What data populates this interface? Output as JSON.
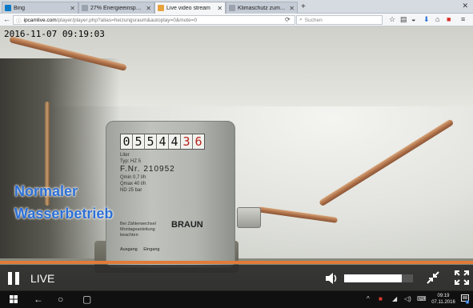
{
  "browser": {
    "tabs": [
      {
        "title": "Bing",
        "favicon_color": "#0a7ac4",
        "active": false
      },
      {
        "title": "27% Energieeinsparung - Hei...",
        "favicon_color": "#9aa3ad",
        "active": false
      },
      {
        "title": "Live video stream",
        "favicon_color": "#e8a341",
        "active": true
      },
      {
        "title": "Klimaschutz zum Nulltarif - H...",
        "favicon_color": "#9aa3ad",
        "active": false
      }
    ],
    "new_tab_label": "+",
    "url_domain": "ipcamlive.com",
    "url_path": "/player/player.php?alias=heizungsraum&autoplay=0&mute=0",
    "search_placeholder": "Suchen"
  },
  "video": {
    "timestamp": "2016-11-07  09:19:03",
    "overlay_line1": "Normaler",
    "overlay_line2": "Wasserbetrieb",
    "meter": {
      "digits": [
        "0",
        "5",
        "5",
        "4",
        "4",
        "3",
        "6"
      ],
      "red_digits_from": 5,
      "unit": "Liter",
      "typ": "Typ: HZ 5",
      "fnr": "F.Nr. 210952",
      "qmin": "Qmin 0,7 l/h",
      "qmax": "Qmax 40 l/h",
      "nd": "ND 25 bar",
      "sub": "Bei Zählerwechsel Montageanleitung beachten",
      "brand": "BRAUN",
      "bottom_left": "Ausgang",
      "bottom_right": "Eingang"
    }
  },
  "player": {
    "live_label": "LIVE",
    "volume_level": 0.84,
    "progress_color": "#e07b39"
  },
  "taskbar": {
    "time": "09:19",
    "date": "07.11.2016",
    "notification_count": "3"
  }
}
